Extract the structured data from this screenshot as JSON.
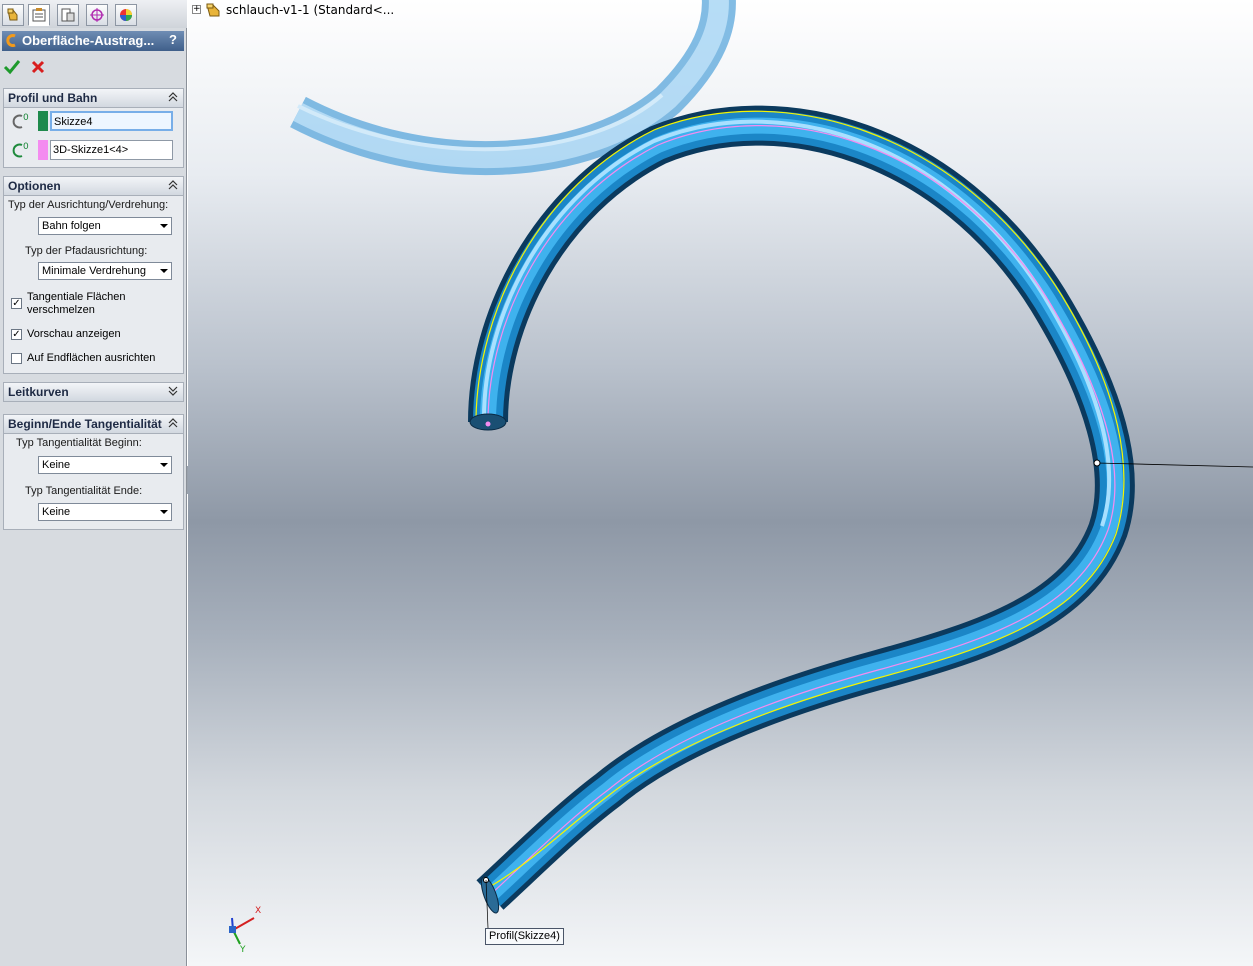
{
  "panel": {
    "tabs": [
      {
        "name": "feature-manager-tab",
        "icon": "feature-tree-icon"
      },
      {
        "name": "property-manager-tab",
        "icon": "property-icon"
      },
      {
        "name": "configuration-manager-tab",
        "icon": "configuration-icon"
      },
      {
        "name": "dimxpert-manager-tab",
        "icon": "crosshair-icon"
      },
      {
        "name": "display-manager-tab",
        "icon": "color-wheel-icon"
      }
    ],
    "title": "Oberfläche-Austrag...",
    "help": "?",
    "ok_icon": "checkmark-icon",
    "cancel_icon": "red-x-icon"
  },
  "profil_bahn": {
    "header": "Profil und Bahn",
    "profile_value": "Skizze4",
    "profile_color": "#1f8a4c",
    "path_value": "3D-Skizze1<4>",
    "path_color": "#f48cf0"
  },
  "optionen": {
    "header": "Optionen",
    "orientation_label": "Typ der Ausrichtung/Verdrehung:",
    "orientation_value": "Bahn folgen",
    "path_align_label": "Typ der Pfadausrichtung:",
    "path_align_value": "Minimale Verdrehung",
    "merge_tangent_label_1": "Tangentiale Flächen",
    "merge_tangent_label_2": "verschmelzen",
    "merge_tangent_checked": true,
    "show_preview_label": "Vorschau anzeigen",
    "show_preview_checked": true,
    "align_end_label": "Auf Endflächen ausrichten",
    "align_end_checked": false
  },
  "leitkurven": {
    "header": "Leitkurven"
  },
  "tangency": {
    "header": "Beginn/Ende Tangentialität",
    "start_label": "Typ Tangentialität Beginn:",
    "start_value": "Keine",
    "end_label": "Typ Tangentialität Ende:",
    "end_value": "Keine"
  },
  "viewport": {
    "tree_text": "schlauch-v1-1  (Standard<...",
    "tree_expander": "+",
    "callout": "Profil(Skizze4)",
    "triad_x": "X",
    "triad_y": "Y",
    "tube_color": "#1e8fd0",
    "ghost_tube_color": "#7fbfe8",
    "path_color": "#f48cf0",
    "guide_color": "#f5f500"
  }
}
